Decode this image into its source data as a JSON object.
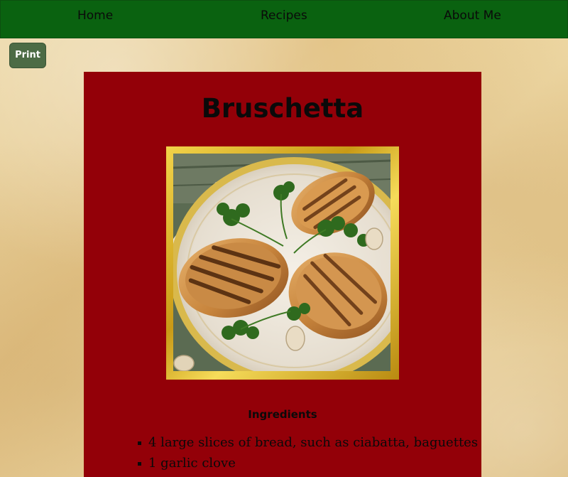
{
  "nav": {
    "home": "Home",
    "recipes": "Recipes",
    "about": "About Me"
  },
  "toolbar": {
    "print_label": "Print"
  },
  "recipe": {
    "title": "Bruschetta",
    "image_subject": "grilled bread slices with parsley and garlic on a plate",
    "ingredients_heading": "Ingredients",
    "ingredients": [
      "4 large slices of bread, such as ciabatta, baguettes",
      "1 garlic clove"
    ]
  },
  "colors": {
    "nav_background": "#0a6210",
    "card_background": "#930008",
    "print_button": "#4c6b45",
    "frame_gold": "#d9ac24",
    "page_background": "#e6cc93"
  }
}
